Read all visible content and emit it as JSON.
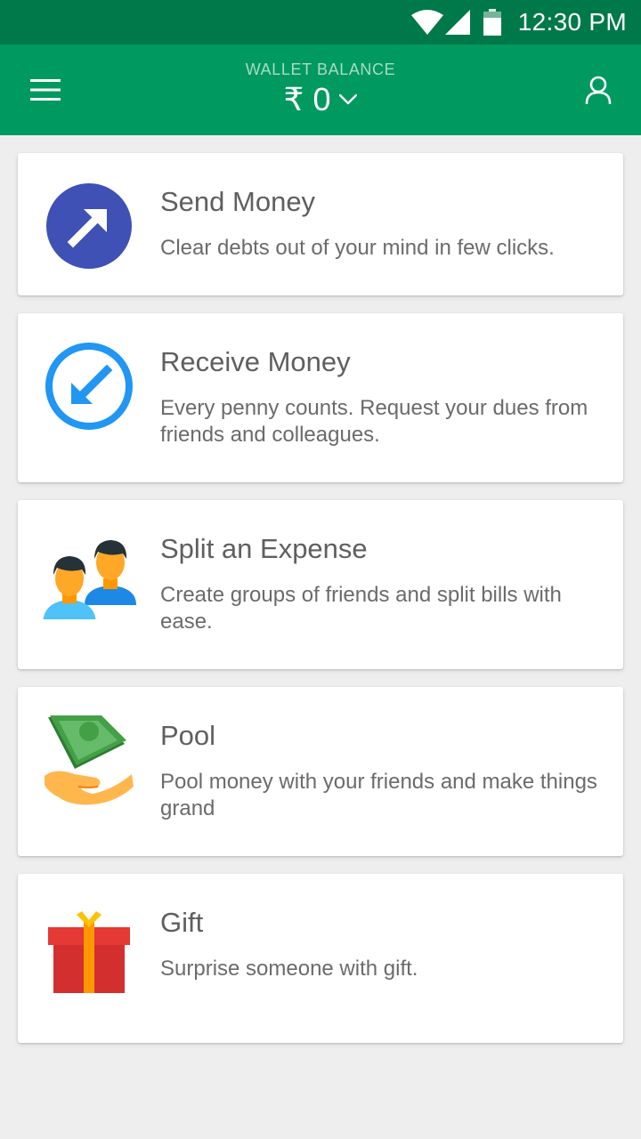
{
  "status_bar": {
    "time": "12:30 PM",
    "icons": [
      "wifi-icon",
      "cell-signal-icon",
      "battery-icon"
    ]
  },
  "header": {
    "wallet_label": "WALLET BALANCE",
    "wallet_amount": "₹ 0",
    "menu_icon": "hamburger-menu-icon",
    "profile_icon": "user-profile-icon",
    "background_color": "#009960",
    "status_bar_color": "#00794a"
  },
  "cards": [
    {
      "id": "send-money",
      "title": "Send Money",
      "description": "Clear debts out of your mind in few clicks.",
      "icon": "send-arrow-icon",
      "icon_color": "#3f51b5"
    },
    {
      "id": "receive-money",
      "title": "Receive Money",
      "description": "Every penny counts. Request your dues from friends and colleagues.",
      "icon": "receive-arrow-icon",
      "icon_color": "#2196f3"
    },
    {
      "id": "split-expense",
      "title": "Split an Expense",
      "description": "Create groups of friends and split bills with ease.",
      "icon": "people-icon"
    },
    {
      "id": "pool",
      "title": "Pool",
      "description": "Pool money with your friends and make things grand",
      "icon": "money-hand-icon"
    },
    {
      "id": "gift",
      "title": "Gift",
      "description": "Surprise someone with gift.",
      "icon": "gift-icon",
      "icon_color": "#d32f2f"
    }
  ]
}
